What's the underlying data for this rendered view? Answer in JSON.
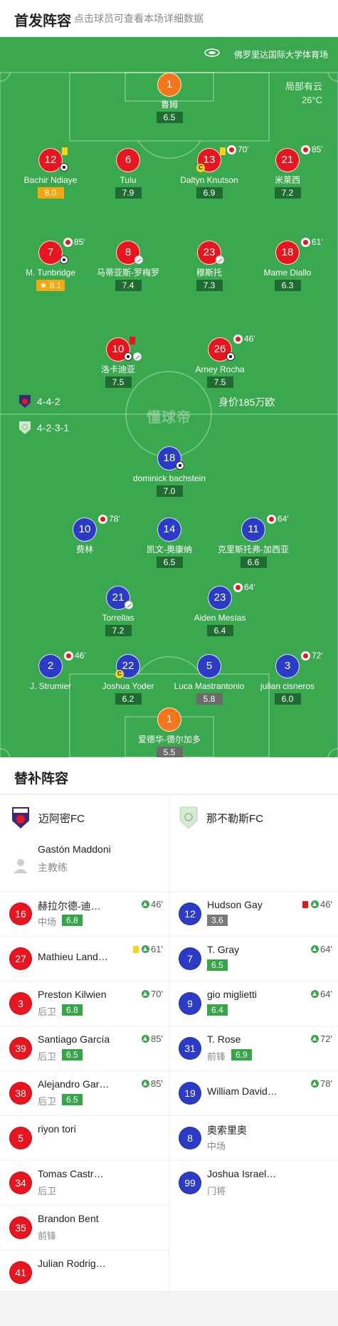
{
  "header": {
    "title": "首发阵容",
    "subtitle": "点击球员可查看本场详细数据"
  },
  "venue": {
    "name": "佛罗里达国际大学体育场",
    "weather": "局部有云",
    "temperature": "26°C"
  },
  "watermark": "懂球帝",
  "home_formation": "4-4-2",
  "away_formation": "4-2-3-1",
  "market_value": "身价185万欧",
  "home_players": [
    {
      "num": "1",
      "name": "鲁姆",
      "rating": "6.5"
    },
    {
      "num": "12",
      "name": "Bachir Ndiaye",
      "rating": "8.0"
    },
    {
      "num": "6",
      "name": "Tulu",
      "rating": "7.9"
    },
    {
      "num": "13",
      "name": "Daltyn Knutson",
      "rating": "6.9",
      "sub_time": "70'"
    },
    {
      "num": "21",
      "name": "米莱西",
      "rating": "7.2",
      "sub_time": "85'"
    },
    {
      "num": "7",
      "name": "M. Tunbridge",
      "rating": "8.1",
      "sub_time": "85'"
    },
    {
      "num": "8",
      "name": "马蒂亚斯-罗梅罗",
      "rating": "7.4"
    },
    {
      "num": "23",
      "name": "穆斯托",
      "rating": "7.3"
    },
    {
      "num": "18",
      "name": "Mame Diallo",
      "rating": "6.3",
      "sub_time": "61'"
    },
    {
      "num": "10",
      "name": "洛卡迪亚",
      "rating": "7.5"
    },
    {
      "num": "26",
      "name": "Arney Rocha",
      "rating": "7.5",
      "sub_time": "46'"
    }
  ],
  "away_players": [
    {
      "num": "18",
      "name": "dominick bachstein",
      "rating": "7.0"
    },
    {
      "num": "10",
      "name": "费林",
      "rating": "",
      "sub_time": "78'"
    },
    {
      "num": "14",
      "name": "凯文-奥康纳",
      "rating": "6.5"
    },
    {
      "num": "11",
      "name": "克里斯托弗-加西亚",
      "rating": "6.6",
      "sub_time": "64'"
    },
    {
      "num": "21",
      "name": "Torrellas",
      "rating": "7.2"
    },
    {
      "num": "23",
      "name": "Aiden Mesías",
      "rating": "6.4",
      "sub_time": "64'"
    },
    {
      "num": "2",
      "name": "J. Strumier",
      "rating": "",
      "sub_time": "46'"
    },
    {
      "num": "22",
      "name": "Joshua Yoder",
      "rating": "6.2"
    },
    {
      "num": "5",
      "name": "Luca Mastrantonio",
      "rating": "5.8"
    },
    {
      "num": "3",
      "name": "julian cisneros",
      "rating": "6.0",
      "sub_time": "72'"
    },
    {
      "num": "1",
      "name": "爱德华-德尔加多",
      "rating": "5.5"
    }
  ],
  "subs": {
    "title": "替补阵容",
    "home_team": "迈阿密FC",
    "away_team": "那不勒斯FC",
    "coach_name": "Gastón Maddoni",
    "coach_role": "主教练",
    "home": [
      {
        "num": "16",
        "name": "赫拉尔德-迪…",
        "pos": "中场",
        "rating": "6.8",
        "time": "46'"
      },
      {
        "num": "27",
        "name": "Mathieu Land…",
        "pos": "",
        "rating": "",
        "time": "61'"
      },
      {
        "num": "3",
        "name": "Preston Kilwien",
        "pos": "后卫",
        "rating": "6.8",
        "time": "70'"
      },
      {
        "num": "39",
        "name": "Santiago García",
        "pos": "后卫",
        "rating": "6.5",
        "time": "85'"
      },
      {
        "num": "38",
        "name": "Alejandro Gar…",
        "pos": "后卫",
        "rating": "6.5",
        "time": "85'"
      },
      {
        "num": "5",
        "name": "riyon tori",
        "pos": "",
        "rating": "",
        "time": ""
      },
      {
        "num": "34",
        "name": "Tomas Castr…",
        "pos": "后卫",
        "rating": "",
        "time": ""
      },
      {
        "num": "35",
        "name": "Brandon Bent",
        "pos": "前锋",
        "rating": "",
        "time": ""
      },
      {
        "num": "41",
        "name": "Julian Rodrig…",
        "pos": "",
        "rating": "",
        "time": ""
      }
    ],
    "away": [
      {
        "num": "12",
        "name": "Hudson Gay",
        "pos": "",
        "rating": "3.6",
        "time": "46'"
      },
      {
        "num": "7",
        "name": "T. Gray",
        "pos": "",
        "rating": "6.5",
        "time": "64'"
      },
      {
        "num": "9",
        "name": "gio miglietti",
        "pos": "",
        "rating": "6.4",
        "time": "64'"
      },
      {
        "num": "31",
        "name": "T. Rose",
        "pos": "前锋",
        "rating": "6.9",
        "time": "72'"
      },
      {
        "num": "19",
        "name": "William David…",
        "pos": "",
        "rating": "",
        "time": "78'"
      },
      {
        "num": "8",
        "name": "奥索里奥",
        "pos": "中场",
        "rating": "",
        "time": ""
      },
      {
        "num": "99",
        "name": "Joshua Israel…",
        "pos": "门将",
        "rating": "",
        "time": ""
      }
    ]
  },
  "colors": {
    "home": "#e8141e",
    "away": "#2b3bc6",
    "goalkeeper": "#f6761b",
    "pitch": "#3aa84e"
  }
}
